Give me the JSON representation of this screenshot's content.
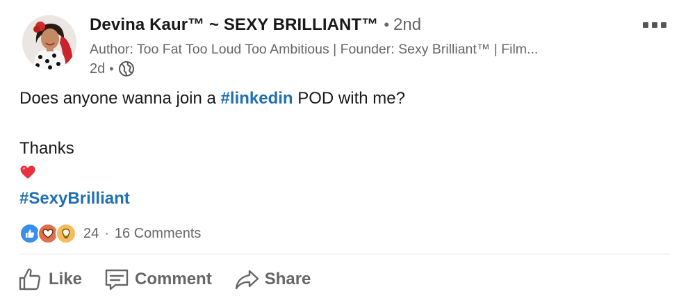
{
  "post": {
    "author": {
      "name": "Devina Kaur™ ~ SEXY BRILLIANT™",
      "separator": "•",
      "degree": "2nd",
      "headline": "Author: Too Fat Too Loud Too Ambitious | Founder: Sexy Brilliant™ | Film...",
      "time": "2d",
      "time_separator": "•",
      "visibility_icon": "globe-icon"
    },
    "body": {
      "line1_prefix": "Does anyone wanna join a ",
      "line1_hashtag": "#linkedin",
      "line1_suffix": " POD with me?",
      "line2": "Thanks",
      "line3_emoji": "red-heart-emoji",
      "line4_hashtag": "#SexyBrilliant"
    },
    "social_counts": {
      "reactions": [
        "like",
        "love",
        "insightful"
      ],
      "reaction_count": "24",
      "separator": "·",
      "comments": "16 Comments"
    },
    "actions": [
      {
        "label": "Like",
        "icon": "thumbs-up-icon"
      },
      {
        "label": "Comment",
        "icon": "comment-icon"
      },
      {
        "label": "Share",
        "icon": "share-arrow-icon"
      }
    ],
    "colors": {
      "hashtag": "#1f6fb2",
      "like": "#378fe9",
      "love": "#df704d",
      "insightful": "#f5bb5c",
      "secondary_text": "#666666"
    }
  }
}
